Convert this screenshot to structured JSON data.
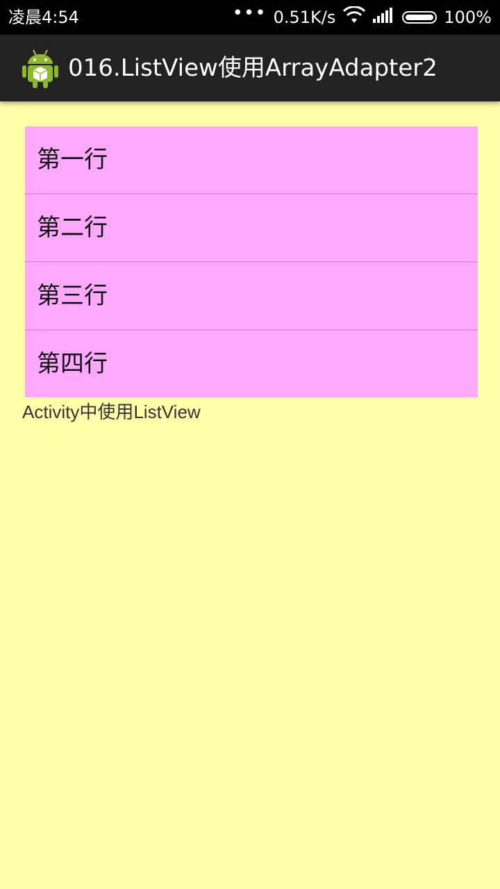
{
  "status_bar": {
    "time": "凌晨4:54",
    "dots": "•••",
    "network_speed": "0.51K/s",
    "battery_percent": "100%",
    "icons": [
      "wifi-icon",
      "signal-icon",
      "battery-icon"
    ]
  },
  "action_bar": {
    "title": "016.ListView使用ArrayAdapter2",
    "icon": "android-app-icon"
  },
  "list": {
    "items": [
      {
        "label": "第一行"
      },
      {
        "label": "第二行"
      },
      {
        "label": "第三行"
      },
      {
        "label": "第四行"
      }
    ]
  },
  "footer": {
    "text": "Activity中使用ListView"
  },
  "colors": {
    "background": "#FFFFAA",
    "list_background": "#FFA8FF",
    "divider": "#E090E0",
    "action_bar": "#222222",
    "status_bar": "#000000"
  }
}
